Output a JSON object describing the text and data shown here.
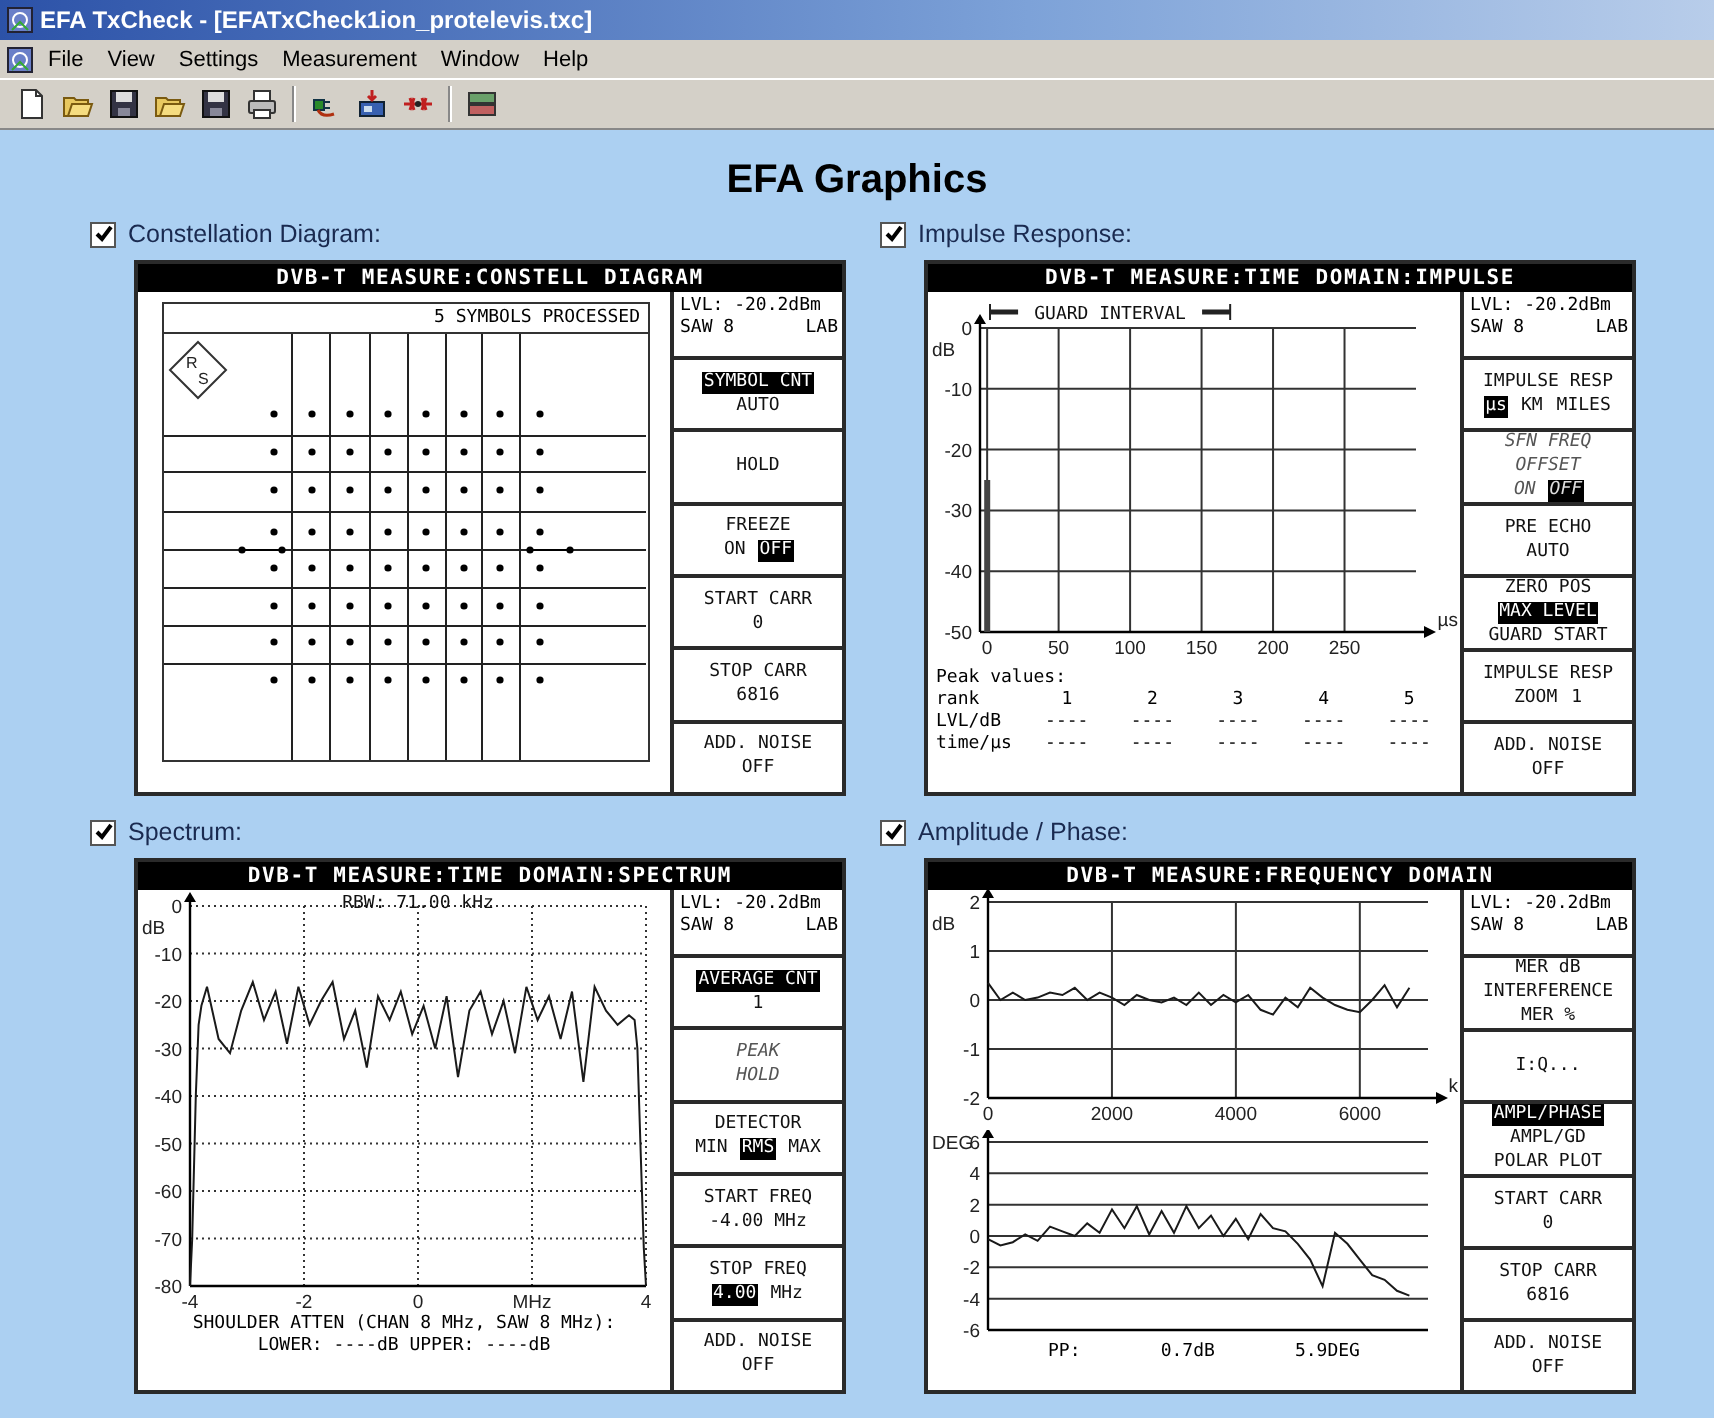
{
  "window": {
    "title": "EFA TxCheck - [EFATxCheck1ion_protelevis.txc]"
  },
  "menu": [
    "File",
    "View",
    "Settings",
    "Measurement",
    "Window",
    "Help"
  ],
  "heading": "EFA Graphics",
  "panels": [
    {
      "kind": "constellation",
      "checkbox": {
        "label": "Constellation Diagram:",
        "checked": true
      },
      "header": "DVB-T MEASURE:CONSTELL DIAGRAM",
      "level": "LVL: -20.2dBm",
      "saw": "SAW 8",
      "mode": "LAB",
      "symbols_processed": "5 SYMBOLS PROCESSED",
      "logo": [
        "R",
        "S"
      ],
      "softkeys": [
        {
          "disabled": false,
          "lines": [
            [
              {
                "text": "SYMBOL CNT",
                "selected": true
              }
            ],
            [
              {
                "text": "AUTO",
                "selected": false
              }
            ]
          ]
        },
        {
          "disabled": false,
          "lines": [
            [
              {
                "text": "HOLD",
                "selected": false
              }
            ]
          ]
        },
        {
          "disabled": false,
          "lines": [
            [
              {
                "text": "FREEZE",
                "selected": false
              }
            ],
            [
              {
                "text": "ON",
                "selected": false
              },
              {
                "text": "OFF",
                "selected": true
              }
            ]
          ]
        },
        {
          "disabled": false,
          "lines": [
            [
              {
                "text": "START CARR",
                "selected": false
              }
            ],
            [
              {
                "text": "0",
                "selected": false
              }
            ]
          ]
        },
        {
          "disabled": false,
          "lines": [
            [
              {
                "text": "STOP CARR",
                "selected": false
              }
            ],
            [
              {
                "text": "6816",
                "selected": false
              }
            ]
          ]
        },
        {
          "disabled": false,
          "lines": [
            [
              {
                "text": "ADD. NOISE",
                "selected": false
              }
            ],
            [
              {
                "text": "OFF",
                "selected": false
              }
            ]
          ]
        }
      ]
    },
    {
      "kind": "impulse",
      "checkbox": {
        "label": "Impulse Response:",
        "checked": true
      },
      "header": "DVB-T MEASURE:TIME DOMAIN:IMPULSE",
      "level": "LVL: -20.2dBm",
      "saw": "SAW 8",
      "mode": "LAB",
      "chart_data": {
        "type": "line",
        "grid": true,
        "x": [
          0,
          0
        ],
        "series": [
          {
            "color": "#444444",
            "values": [
              -50,
              -25
            ]
          }
        ],
        "xlim": [
          -5,
          300
        ],
        "ylim": [
          -50,
          0
        ],
        "xticks": [
          0,
          50,
          100,
          150,
          200,
          250
        ],
        "yticks": [
          0,
          -10,
          -20,
          -30,
          -40,
          -50
        ],
        "xlabel": "µs",
        "ylabel": "dB",
        "annotations": [
          "GUARD INTERVAL"
        ]
      },
      "peak_table": {
        "title": "Peak values:",
        "rows": [
          {
            "label": "rank",
            "cells": [
              "1",
              "2",
              "3",
              "4",
              "5"
            ]
          },
          {
            "label": "LVL/dB",
            "cells": [
              "----",
              "----",
              "----",
              "----",
              "----"
            ]
          },
          {
            "label": "time/µs",
            "cells": [
              "----",
              "----",
              "----",
              "----",
              "----"
            ]
          }
        ]
      },
      "softkeys": [
        {
          "disabled": false,
          "lines": [
            [
              {
                "text": "IMPULSE RESP",
                "selected": false
              }
            ],
            [
              {
                "text": "µs",
                "selected": true
              },
              {
                "text": "KM",
                "selected": false
              },
              {
                "text": "MILES",
                "selected": false
              }
            ]
          ]
        },
        {
          "disabled": true,
          "lines": [
            [
              {
                "text": "SFN FREQ",
                "selected": false
              }
            ],
            [
              {
                "text": "OFFSET",
                "selected": false
              }
            ],
            [
              {
                "text": "ON",
                "selected": false
              },
              {
                "text": "OFF",
                "selected": true
              }
            ]
          ]
        },
        {
          "disabled": false,
          "lines": [
            [
              {
                "text": "PRE ECHO",
                "selected": false
              }
            ],
            [
              {
                "text": "AUTO",
                "selected": false
              }
            ]
          ]
        },
        {
          "disabled": false,
          "lines": [
            [
              {
                "text": "ZERO POS",
                "selected": false
              }
            ],
            [
              {
                "text": "MAX LEVEL",
                "selected": true
              }
            ],
            [
              {
                "text": "GUARD START",
                "selected": false
              }
            ]
          ]
        },
        {
          "disabled": false,
          "lines": [
            [
              {
                "text": "IMPULSE RESP",
                "selected": false
              }
            ],
            [
              {
                "text": "ZOOM",
                "selected": false
              },
              {
                "text": "1",
                "selected": false
              }
            ]
          ]
        },
        {
          "disabled": false,
          "lines": [
            [
              {
                "text": "ADD. NOISE",
                "selected": false
              }
            ],
            [
              {
                "text": "OFF",
                "selected": false
              }
            ]
          ]
        }
      ]
    },
    {
      "kind": "spectrum",
      "checkbox": {
        "label": "Spectrum:",
        "checked": true
      },
      "header": "DVB-T MEASURE:TIME DOMAIN:SPECTRUM",
      "level": "LVL: -20.2dBm",
      "saw": "SAW 8",
      "mode": "LAB",
      "chart_data": {
        "type": "line",
        "grid": true,
        "title": "RBW: 71.00 kHz",
        "ylabel": "dB",
        "xlim": [
          -4,
          4
        ],
        "ylim": [
          -80,
          0
        ],
        "xticks": [
          -4,
          -2,
          0,
          {
            "value": 2,
            "label": "MHz"
          },
          4
        ],
        "yticks": [
          0,
          -10,
          -20,
          -30,
          -40,
          -50,
          -60,
          -70,
          -80
        ],
        "x": [
          -4,
          -3.96,
          -3.9,
          -3.85,
          -3.8,
          -3.7,
          -3.5,
          -3.3,
          -3.1,
          -2.9,
          -2.7,
          -2.5,
          -2.3,
          -2.1,
          -1.9,
          -1.7,
          -1.5,
          -1.3,
          -1.1,
          -0.9,
          -0.7,
          -0.5,
          -0.3,
          -0.1,
          0.1,
          0.3,
          0.5,
          0.7,
          0.9,
          1.1,
          1.3,
          1.5,
          1.7,
          1.9,
          2.1,
          2.3,
          2.5,
          2.7,
          2.9,
          3.1,
          3.3,
          3.5,
          3.7,
          3.8,
          3.85,
          3.9,
          3.96,
          4
        ],
        "series": [
          {
            "color": "#1a1a1a",
            "values": [
              -80,
              -70,
              -40,
              -25,
              -21,
              -17,
              -28,
              -31,
              -22,
              -16,
              -24,
              -18,
              -29,
              -17,
              -25,
              -20,
              -16,
              -28,
              -22,
              -34,
              -19,
              -24,
              -18,
              -27,
              -21,
              -30,
              -19,
              -36,
              -22,
              -18,
              -27,
              -20,
              -31,
              -17,
              -24,
              -19,
              -28,
              -18,
              -37,
              -17,
              -22,
              -25,
              -23,
              -24,
              -30,
              -50,
              -72,
              -80
            ]
          }
        ]
      },
      "shoulder": [
        "SHOULDER ATTEN (CHAN 8 MHz, SAW 8 MHz):",
        "LOWER: ----dB  UPPER: ----dB"
      ],
      "softkeys": [
        {
          "disabled": false,
          "lines": [
            [
              {
                "text": "AVERAGE CNT",
                "selected": true
              }
            ],
            [
              {
                "text": "1",
                "selected": false
              }
            ]
          ]
        },
        {
          "disabled": true,
          "lines": [
            [
              {
                "text": "PEAK",
                "selected": false
              }
            ],
            [
              {
                "text": "HOLD",
                "selected": false
              }
            ]
          ]
        },
        {
          "disabled": false,
          "lines": [
            [
              {
                "text": "DETECTOR",
                "selected": false
              }
            ],
            [
              {
                "text": "MIN",
                "selected": false
              },
              {
                "text": "RMS",
                "selected": true
              },
              {
                "text": "MAX",
                "selected": false
              }
            ]
          ]
        },
        {
          "disabled": false,
          "lines": [
            [
              {
                "text": "START FREQ",
                "selected": false
              }
            ],
            [
              {
                "text": "-4.00 MHz",
                "selected": false
              }
            ]
          ]
        },
        {
          "disabled": false,
          "lines": [
            [
              {
                "text": "STOP FREQ",
                "selected": false
              }
            ],
            [
              {
                "text": "4.00",
                "selected": true
              },
              {
                "text": "MHz",
                "selected": false
              }
            ]
          ]
        },
        {
          "disabled": false,
          "lines": [
            [
              {
                "text": "ADD. NOISE",
                "selected": false
              }
            ],
            [
              {
                "text": "OFF",
                "selected": false
              }
            ]
          ]
        }
      ]
    },
    {
      "kind": "frequency",
      "checkbox": {
        "label": "Amplitude / Phase:",
        "checked": true
      },
      "header": "DVB-T MEASURE:FREQUENCY DOMAIN",
      "level": "LVL: -20.2dBm",
      "saw": "SAW 8",
      "mode": "LAB",
      "amplitude": {
        "chart_data": {
          "type": "line",
          "grid": true,
          "ylabel": "dB",
          "xlabel": "k",
          "xlim": [
            0,
            7100
          ],
          "ylim": [
            -2,
            2
          ],
          "xticks": [
            0,
            2000,
            4000,
            6000
          ],
          "yticks": [
            2,
            1,
            0,
            -1,
            -2
          ],
          "x": [
            0,
            200,
            400,
            600,
            800,
            1000,
            1200,
            1400,
            1600,
            1800,
            2000,
            2200,
            2400,
            2600,
            2800,
            3000,
            3200,
            3400,
            3600,
            3800,
            4000,
            4200,
            4400,
            4600,
            4800,
            5000,
            5200,
            5400,
            5600,
            5800,
            6000,
            6200,
            6400,
            6600,
            6800
          ],
          "series": [
            {
              "color": "#1a1a1a",
              "values": [
                0.35,
                0.0,
                0.15,
                0.0,
                0.05,
                0.15,
                0.1,
                0.25,
                0.0,
                0.15,
                0.05,
                -0.1,
                0.1,
                0.0,
                -0.05,
                0.05,
                -0.1,
                0.15,
                -0.1,
                0.1,
                -0.05,
                0.1,
                -0.2,
                -0.3,
                0.05,
                -0.15,
                0.25,
                0.05,
                -0.1,
                -0.2,
                -0.25,
                0.0,
                0.3,
                -0.15,
                0.25
              ]
            }
          ]
        }
      },
      "phase": {
        "chart_data": {
          "type": "line",
          "grid": true,
          "ylabel": "DEG",
          "xlim": [
            0,
            7100
          ],
          "ylim": [
            -6,
            6
          ],
          "yticks": [
            6,
            4,
            2,
            0,
            -2,
            -4,
            -6
          ],
          "x": [
            0,
            200,
            400,
            600,
            800,
            1000,
            1200,
            1400,
            1600,
            1800,
            2000,
            2200,
            2400,
            2600,
            2800,
            3000,
            3200,
            3400,
            3600,
            3800,
            4000,
            4200,
            4400,
            4600,
            4800,
            5000,
            5200,
            5400,
            5600,
            5800,
            6000,
            6200,
            6400,
            6600,
            6800
          ],
          "series": [
            {
              "color": "#1a1a1a",
              "values": [
                -0.2,
                -0.6,
                -0.4,
                0.1,
                -0.3,
                0.6,
                0.3,
                0.0,
                0.8,
                0.2,
                1.7,
                0.5,
                1.9,
                0.1,
                1.6,
                0.2,
                1.9,
                0.5,
                1.3,
                0.0,
                1.1,
                -0.2,
                1.4,
                0.5,
                0.3,
                -0.5,
                -1.5,
                -3.2,
                0.2,
                -0.5,
                -1.5,
                -2.5,
                -2.8,
                -3.5,
                -3.8
              ]
            }
          ]
        }
      },
      "footer": [
        "PP:",
        "0.7dB",
        "5.9DEG"
      ],
      "softkeys": [
        {
          "disabled": false,
          "lines": [
            [
              {
                "text": "MER dB",
                "selected": false
              }
            ],
            [
              {
                "text": "INTERFERENCE",
                "selected": false
              }
            ],
            [
              {
                "text": "MER %",
                "selected": false
              }
            ]
          ]
        },
        {
          "disabled": false,
          "lines": [
            [
              {
                "text": "I:Q...",
                "selected": false
              }
            ]
          ]
        },
        {
          "disabled": false,
          "lines": [
            [
              {
                "text": "AMPL/PHASE",
                "selected": true
              }
            ],
            [
              {
                "text": "AMPL/GD",
                "selected": false
              }
            ],
            [
              {
                "text": "POLAR PLOT",
                "selected": false
              }
            ]
          ]
        },
        {
          "disabled": false,
          "lines": [
            [
              {
                "text": "START CARR",
                "selected": false
              }
            ],
            [
              {
                "text": "0",
                "selected": false
              }
            ]
          ]
        },
        {
          "disabled": false,
          "lines": [
            [
              {
                "text": "STOP CARR",
                "selected": false
              }
            ],
            [
              {
                "text": "6816",
                "selected": false
              }
            ]
          ]
        },
        {
          "disabled": false,
          "lines": [
            [
              {
                "text": "ADD. NOISE",
                "selected": false
              }
            ],
            [
              {
                "text": "OFF",
                "selected": false
              }
            ]
          ]
        }
      ]
    }
  ]
}
